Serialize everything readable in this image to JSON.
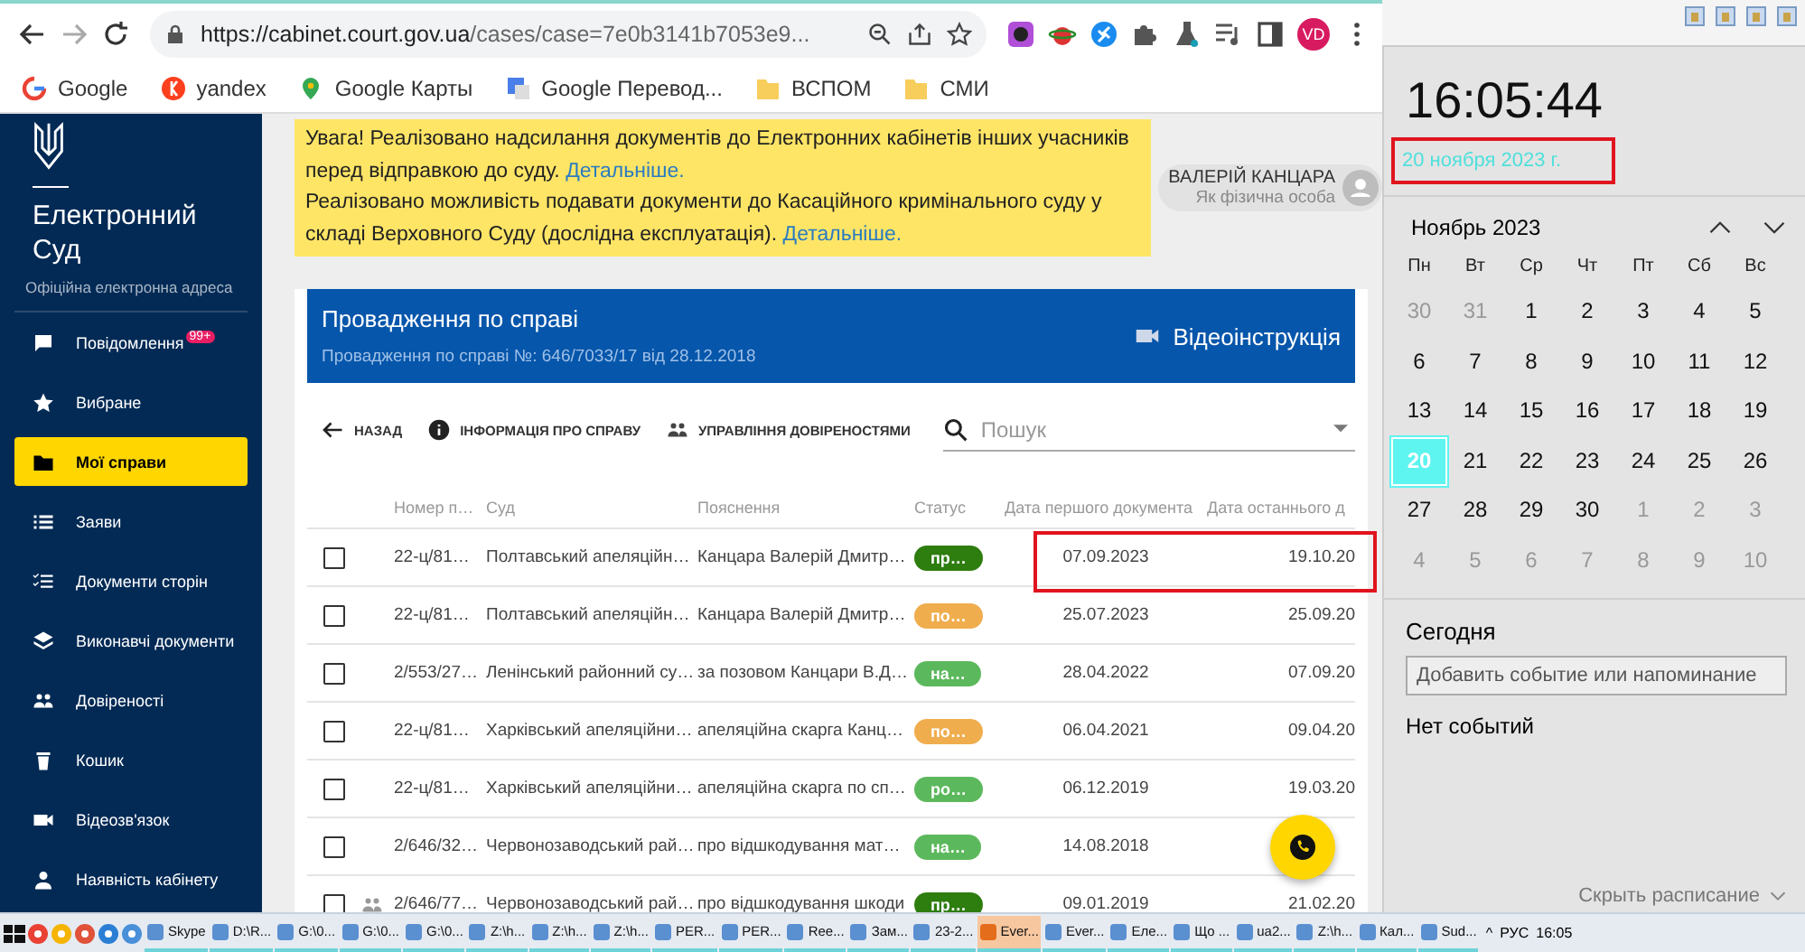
{
  "browser": {
    "url_host": "https://cabinet.court.gov.ua",
    "url_path": "/cases/case=7e0b3141b7053e9...",
    "avatar": "VD",
    "bookmarks": [
      {
        "kind": "google",
        "label": "Google"
      },
      {
        "kind": "yandex",
        "label": "yandex"
      },
      {
        "kind": "maps",
        "label": "Google Карты"
      },
      {
        "kind": "translate",
        "label": "Google Перевод..."
      },
      {
        "kind": "folder",
        "label": "ВСПОМ"
      },
      {
        "kind": "folder",
        "label": "СМИ"
      }
    ]
  },
  "sidebar": {
    "title": "Електронний Суд",
    "subtitle": "Офіційна електронна адреса",
    "items": [
      {
        "kind": "chat",
        "label": "Повідомлення",
        "badge": "99+",
        "selected": false
      },
      {
        "kind": "star",
        "label": "Вибране",
        "selected": false
      },
      {
        "kind": "folder",
        "label": "Мої справи",
        "selected": true
      },
      {
        "kind": "list",
        "label": "Заяви",
        "selected": false
      },
      {
        "kind": "checklist",
        "label": "Документи сторін",
        "selected": false
      },
      {
        "kind": "layers",
        "label": "Виконавчі документи",
        "selected": false
      },
      {
        "kind": "people",
        "label": "Довіреності",
        "selected": false
      },
      {
        "kind": "trash",
        "label": "Кошик",
        "selected": false
      },
      {
        "kind": "video",
        "label": "Відеозв'язок",
        "selected": false
      },
      {
        "kind": "person",
        "label": "Наявність кабінету",
        "selected": false
      }
    ]
  },
  "notice": [
    {
      "text": "Увага! Реалізовано надсилання документів до Електронних кабінетів інших учасників перед відправкою до суду.",
      "link": "Детальніше."
    },
    {
      "text": "Реалізовано можливість подавати документи до Касаційного кримінального суду у складі Верховного Суду (дослідна експлуатація).",
      "link": "Детальніше."
    }
  ],
  "user": {
    "name": "ВАЛЕРІЙ КАНЦАРА",
    "role": "Як фізична особа"
  },
  "case_header": {
    "title": "Провадження по справі",
    "subtitle": "Провадження по справі №: 646/7033/17 від 28.12.2018",
    "video_link": "Відеоінструкція"
  },
  "toolbar": {
    "back": "НАЗАД",
    "info": "ІНФОРМАЦІЯ ПРО СПРАВУ",
    "trust": "УПРАВЛІННЯ ДОВІРЕНОСТЯМИ",
    "search_placeholder": "Пошук"
  },
  "table": {
    "columns": [
      "Номер п…",
      "Суд",
      "Пояснення",
      "Статус",
      "Дата першого документа",
      "Дата останнього д"
    ],
    "rows": [
      {
        "checked": false,
        "shared": false,
        "number": "22-ц/81…",
        "court": "Полтавський апеляційн…",
        "note": "Канцара Валерій Дмитр…",
        "status": "пр…",
        "color": "#2e7d0f",
        "first": "07.09.2023",
        "last": "19.10.20",
        "highlighted": true
      },
      {
        "checked": false,
        "shared": false,
        "number": "22-ц/81…",
        "court": "Полтавський апеляційн…",
        "note": "Канцара Валерій Дмитр…",
        "status": "по…",
        "color": "#f0ad4e",
        "first": "25.07.2023",
        "last": "25.09.20",
        "highlighted": false
      },
      {
        "checked": false,
        "shared": false,
        "number": "2/553/27…",
        "court": "Ленінський районний су…",
        "note": "за позовом Канцари В.Д…",
        "status": "на…",
        "color": "#5cb85c",
        "first": "28.04.2022",
        "last": "07.09.20",
        "highlighted": false
      },
      {
        "checked": false,
        "shared": false,
        "number": "22-ц/81…",
        "court": "Харківський апеляційни…",
        "note": "апеляційна скарга Канц…",
        "status": "по…",
        "color": "#f0ad4e",
        "first": "06.04.2021",
        "last": "09.04.20",
        "highlighted": false
      },
      {
        "checked": false,
        "shared": false,
        "number": "22-ц/81…",
        "court": "Харківський апеляційни…",
        "note": "апеляційна скарга по сп…",
        "status": "ро…",
        "color": "#5cb85c",
        "first": "06.12.2019",
        "last": "19.03.20",
        "highlighted": false
      },
      {
        "checked": false,
        "shared": false,
        "number": "2/646/32…",
        "court": "Червонозаводський рай…",
        "note": "про відшкодування мат…",
        "status": "на…",
        "color": "#5cb85c",
        "first": "14.08.2018",
        "highlighted": false
      },
      {
        "checked": false,
        "shared": true,
        "number": "2/646/77…",
        "court": "Червонозаводський рай…",
        "note": "про відшкодування шкоди",
        "status": "пр…",
        "color": "#2e7d0f",
        "first": "09.01.2019",
        "last": "21.02.20",
        "highlighted": false
      }
    ]
  },
  "calendar": {
    "time": "16:05:44",
    "date": "20 ноября 2023 г.",
    "date_highlighted": true,
    "month": "Ноябрь 2023",
    "weekdays": [
      "Пн",
      "Вт",
      "Ср",
      "Чт",
      "Пт",
      "Сб",
      "Вс"
    ],
    "days": [
      {
        "day": "30",
        "current": false,
        "selected": false
      },
      {
        "day": "31",
        "current": false,
        "selected": false
      },
      {
        "day": "1",
        "current": true,
        "selected": false
      },
      {
        "day": "2",
        "current": true,
        "selected": false
      },
      {
        "day": "3",
        "current": true,
        "selected": false
      },
      {
        "day": "4",
        "current": true,
        "selected": false
      },
      {
        "day": "5",
        "current": true,
        "selected": false
      },
      {
        "day": "6",
        "current": true,
        "selected": false
      },
      {
        "day": "7",
        "current": true,
        "selected": false
      },
      {
        "day": "8",
        "current": true,
        "selected": false
      },
      {
        "day": "9",
        "current": true,
        "selected": false
      },
      {
        "day": "10",
        "current": true,
        "selected": false
      },
      {
        "day": "11",
        "current": true,
        "selected": false
      },
      {
        "day": "12",
        "current": true,
        "selected": false
      },
      {
        "day": "13",
        "current": true,
        "selected": false
      },
      {
        "day": "14",
        "current": true,
        "selected": false
      },
      {
        "day": "15",
        "current": true,
        "selected": false
      },
      {
        "day": "16",
        "current": true,
        "selected": false
      },
      {
        "day": "17",
        "current": true,
        "selected": false
      },
      {
        "day": "18",
        "current": true,
        "selected": false
      },
      {
        "day": "19",
        "current": true,
        "selected": false
      },
      {
        "day": "20",
        "current": true,
        "selected": true
      },
      {
        "day": "21",
        "current": true,
        "selected": false
      },
      {
        "day": "22",
        "current": true,
        "selected": false
      },
      {
        "day": "23",
        "current": true,
        "selected": false
      },
      {
        "day": "24",
        "current": true,
        "selected": false
      },
      {
        "day": "25",
        "current": true,
        "selected": false
      },
      {
        "day": "26",
        "current": true,
        "selected": false
      },
      {
        "day": "27",
        "current": true,
        "selected": false
      },
      {
        "day": "28",
        "current": true,
        "selected": false
      },
      {
        "day": "29",
        "current": true,
        "selected": false
      },
      {
        "day": "30",
        "current": true,
        "selected": false
      },
      {
        "day": "1",
        "current": false,
        "selected": false
      },
      {
        "day": "2",
        "current": false,
        "selected": false
      },
      {
        "day": "3",
        "current": false,
        "selected": false
      },
      {
        "day": "4",
        "current": false,
        "selected": false
      },
      {
        "day": "5",
        "current": false,
        "selected": false
      },
      {
        "day": "6",
        "current": false,
        "selected": false
      },
      {
        "day": "7",
        "current": false,
        "selected": false
      },
      {
        "day": "8",
        "current": false,
        "selected": false
      },
      {
        "day": "9",
        "current": false,
        "selected": false
      },
      {
        "day": "10",
        "current": false,
        "selected": false
      }
    ],
    "today_label": "Сегодня",
    "event_placeholder": "Добавить событие или напоминание",
    "no_events": "Нет событий",
    "hide_schedule": "Скрыть расписание"
  },
  "taskbar": {
    "items": [
      {
        "label": "Skype",
        "active": false
      },
      {
        "label": "D:\\R...",
        "active": false
      },
      {
        "label": "G:\\0...",
        "active": false
      },
      {
        "label": "G:\\0...",
        "active": false
      },
      {
        "label": "G:\\0...",
        "active": false
      },
      {
        "label": "Z:\\h...",
        "active": false
      },
      {
        "label": "Z:\\h...",
        "active": false
      },
      {
        "label": "Z:\\h...",
        "active": false
      },
      {
        "label": "PER...",
        "active": false
      },
      {
        "label": "PER...",
        "active": false
      },
      {
        "label": "Ree...",
        "active": false
      },
      {
        "label": "Зам...",
        "active": false
      },
      {
        "label": "23-2...",
        "active": false
      },
      {
        "label": "Ever...",
        "active": true
      },
      {
        "label": "Ever...",
        "active": false
      },
      {
        "label": "Еле...",
        "active": false
      },
      {
        "label": "Що ...",
        "active": false
      },
      {
        "label": "ua2...",
        "active": false
      },
      {
        "label": "Z:\\h...",
        "active": false
      },
      {
        "label": "Кал...",
        "active": false
      },
      {
        "label": "Sud...",
        "active": false
      }
    ],
    "tray_caret": "^",
    "language": "РУС",
    "clock": "16:05"
  }
}
